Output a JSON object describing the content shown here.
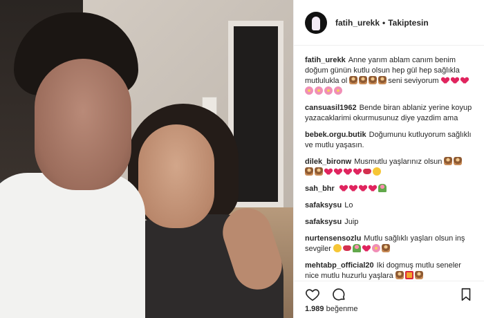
{
  "post": {
    "username": "fatih_urekk",
    "separator": "•",
    "follow_status": "Takiptesin"
  },
  "comments": [
    {
      "user": "fatih_urekk",
      "text": "Anne yarım ablam canım benim doğum günün kutlu olsun hep gül hep sağlıkla mutlulukla ol",
      "emojis_mid": [
        "cake",
        "cake",
        "cake",
        "cake"
      ],
      "text2": "seni seviyorum",
      "emojis_end": [
        "heart",
        "heart",
        "heart",
        "flower",
        "flower",
        "flower",
        "flower"
      ]
    },
    {
      "user": "cansuasil1962",
      "text": "Bende biran ablaniz yerine koyup yazacaklarimi okurmusunuz diye yazdim ama"
    },
    {
      "user": "bebek.orgu.butik",
      "text": "Doğumunu kutluyorum sağlıklı ve mutlu yaşasın."
    },
    {
      "user": "dilek_bironw",
      "text": "Musmutlu yaşlarınız olsun",
      "emojis_end": [
        "cake",
        "cake",
        "cake",
        "cake",
        "heart",
        "heart",
        "heart",
        "heart",
        "lips",
        "smile"
      ]
    },
    {
      "user": "sah_bhr",
      "text": "",
      "emojis_end": [
        "heart",
        "heart",
        "heart",
        "heart",
        "bouquet"
      ]
    },
    {
      "user": "safaksysu",
      "text": "Lo"
    },
    {
      "user": "safaksysu",
      "text": "Juip"
    },
    {
      "user": "nurtensensozlu",
      "text": "Mutlu sağlıklı yaşları olsun inş sevgiler",
      "emojis_end": [
        "smile",
        "lips",
        "bouquet",
        "heart",
        "flower",
        "cake"
      ]
    },
    {
      "user": "mehtabp_official20",
      "text": "Iki dogmuş mutlu seneler nice mutlu huzurlu yaşlara",
      "emojis_end": [
        "cake",
        "gift",
        "cake"
      ]
    }
  ],
  "actions": {
    "like_icon": "heart-outline-icon",
    "comment_icon": "comment-bubble-icon",
    "bookmark_icon": "bookmark-icon",
    "likes_count": "1.989",
    "likes_label": "beğenme"
  },
  "colors": {
    "text": "#262626",
    "border": "#efefef",
    "heart": "#e0245e"
  }
}
